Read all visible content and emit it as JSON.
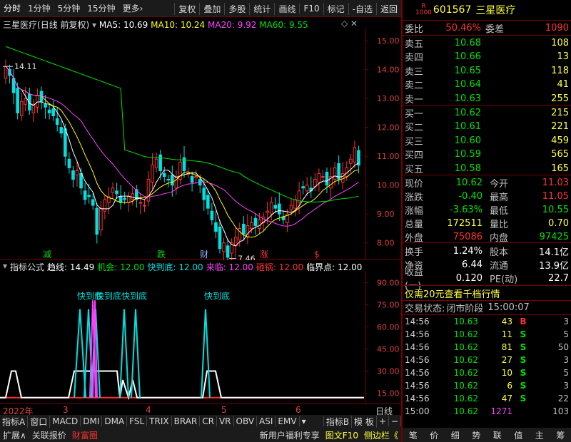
{
  "toolbar": {
    "left": [
      "分时",
      "1分钟",
      "5分钟",
      "15分钟",
      "更多›"
    ],
    "right": [
      "复权",
      "叠加",
      "多股",
      "统计",
      "画线",
      "F10",
      "标记",
      "-自选",
      "返回"
    ]
  },
  "chart": {
    "name": "三星医疗",
    "mode": "(日线 前复权)",
    "ma5": "MA5: 10.69",
    "ma10": "MA10: 10.24",
    "ma20": "MA20: 9.92",
    "ma60": "MA60: 9.55",
    "high_label": "14.11",
    "low_label": "7.46",
    "yaxis": [
      "15.00",
      "14.00",
      "13.00",
      "12.00",
      "11.00",
      "10.00",
      "9.00",
      "8.00"
    ],
    "events": [
      "减",
      "跌",
      "财",
      "涨",
      "$"
    ],
    "ind_name": "指标公式",
    "ind_vals": [
      "趋线: 14.49",
      "机会: 12.00",
      "快到底: 12.00",
      "来临: 12.00",
      "砸锅: 12.00",
      "临界点: 12.00"
    ],
    "ind_yaxis": [
      "90.00",
      "75.00",
      "60.00",
      "45.00",
      "30.00",
      "15.00"
    ],
    "ind_labels": [
      "快到底",
      "快到底",
      "快到底",
      "快到底"
    ],
    "date_labels": [
      "2022年",
      "3",
      "4",
      "5",
      "6"
    ],
    "date_right": "日线"
  },
  "chart_data": {
    "type": "candlestick",
    "title": "三星医疗 (日线 前复权)",
    "ylim": [
      7.5,
      15.2
    ],
    "closes": [
      14.11,
      13.8,
      13.2,
      12.5,
      12.9,
      13.0,
      12.6,
      12.8,
      13.1,
      12.9,
      12.7,
      12.5,
      12.4,
      12.1,
      11.8,
      11.0,
      10.6,
      10.2,
      10.5,
      9.9,
      9.5,
      9.6,
      9.3,
      8.3,
      9.2,
      9.5,
      9.6,
      9.9,
      9.7,
      9.4,
      9.5,
      9.6,
      9.7,
      9.5,
      9.4,
      9.3,
      10.2,
      10.7,
      10.9,
      10.5,
      10.3,
      10.2,
      10.0,
      10.3,
      10.8,
      10.5,
      10.4,
      10.1,
      10.3,
      10.0,
      9.5,
      9.2,
      8.8,
      8.4,
      7.8,
      8.0,
      7.5,
      8.0,
      8.2,
      8.5,
      8.3,
      8.6,
      8.7,
      8.6,
      8.8,
      8.9,
      9.1,
      9.4,
      9.2,
      9.0,
      8.8,
      9.0,
      9.3,
      9.5,
      9.8,
      9.9,
      10.0,
      9.8,
      10.2,
      10.4,
      10.3,
      10.0,
      10.3,
      10.6,
      10.2,
      10.4,
      10.6,
      10.9,
      11.3,
      10.69
    ],
    "ma_lines": [
      "MA5",
      "MA10",
      "MA20",
      "MA60"
    ]
  },
  "panel": {
    "code": "601567",
    "name": "三星医疗",
    "ratio_k": "委比",
    "ratio_v": "50.46%",
    "diff_k": "委差",
    "diff_v": "1090",
    "asks": [
      {
        "label": "卖五",
        "price": "10.68",
        "vol": "108"
      },
      {
        "label": "卖四",
        "price": "10.66",
        "vol": "13"
      },
      {
        "label": "卖三",
        "price": "10.65",
        "vol": "118"
      },
      {
        "label": "卖二",
        "price": "10.64",
        "vol": "41"
      },
      {
        "label": "卖一",
        "price": "10.63",
        "vol": "255"
      }
    ],
    "bids": [
      {
        "label": "买一",
        "price": "10.62",
        "vol": "215"
      },
      {
        "label": "买二",
        "price": "10.61",
        "vol": "221"
      },
      {
        "label": "买三",
        "price": "10.60",
        "vol": "459"
      },
      {
        "label": "买四",
        "price": "10.59",
        "vol": "565"
      },
      {
        "label": "买五",
        "price": "10.58",
        "vol": "165"
      }
    ],
    "stats": [
      {
        "k": "现价",
        "v": "10.62",
        "k2": "今开",
        "v2": "11.03"
      },
      {
        "k": "涨跌",
        "v": "-0.40",
        "k2": "最高",
        "v2": "11.05"
      },
      {
        "k": "涨幅",
        "v": "-3.63%",
        "k2": "最低",
        "v2": "10.55"
      },
      {
        "k": "总量",
        "v": "172511",
        "k2": "量比",
        "v2": "0.70"
      },
      {
        "k": "外盘",
        "v": "75086",
        "k2": "内盘",
        "v2": "97425"
      }
    ],
    "stats2": [
      {
        "k": "换手",
        "v": "1.24%",
        "k2": "股本",
        "v2": "14.1亿"
      },
      {
        "k": "净资",
        "v": "6.44",
        "k2": "流通",
        "v2": "13.9亿"
      },
      {
        "k": "收益(一)",
        "v": "0.120",
        "k2": "PE(动)",
        "v2": "22.7"
      }
    ],
    "promo": "仅需20元查看千档行情",
    "status_k": "交易状态:",
    "status_v": "闭市阶段",
    "status_t": "15:00:07",
    "ticks": [
      {
        "t": "14:56",
        "p": "10.63",
        "q": "43",
        "d": "B",
        "n": "3"
      },
      {
        "t": "14:56",
        "p": "10.62",
        "q": "11",
        "d": "S",
        "n": "5"
      },
      {
        "t": "14:56",
        "p": "10.62",
        "q": "81",
        "d": "S",
        "n": "50"
      },
      {
        "t": "14:56",
        "p": "10.62",
        "q": "27",
        "d": "S",
        "n": "3"
      },
      {
        "t": "14:56",
        "p": "10.62",
        "q": "10",
        "d": "S",
        "n": "5"
      },
      {
        "t": "14:56",
        "p": "10.62",
        "q": "6",
        "d": "S",
        "n": "3"
      },
      {
        "t": "14:56",
        "p": "10.62",
        "q": "47",
        "d": "S",
        "n": "22"
      },
      {
        "t": "15:00",
        "p": "10.62",
        "q": "1271",
        "d": "",
        "n": "103"
      }
    ]
  },
  "bottom": {
    "row1": [
      "指标A",
      "窗口",
      "MACD",
      "DMI",
      "DMA",
      "FSL",
      "TRIX",
      "BRAR",
      "CR",
      "VR",
      "OBV",
      "ASI",
      "EMV",
      "▾",
      "指标B",
      "模 板",
      "+",
      "−"
    ],
    "row2": [
      "扩展∧",
      "关联报价",
      "财富圈"
    ],
    "row2_right": [
      "新用户福利专享",
      "图文F10",
      "侧边栏《"
    ],
    "panel_tabs": [
      "笔",
      "价",
      "细",
      "势",
      "联",
      "值",
      "主",
      "筹"
    ]
  },
  "colors": {
    "up": "#ff3030",
    "down": "#00e0e0",
    "ma5": "#ffffff",
    "ma10": "#ffff00",
    "ma20": "#ff40ff",
    "ma60": "#00e000"
  }
}
